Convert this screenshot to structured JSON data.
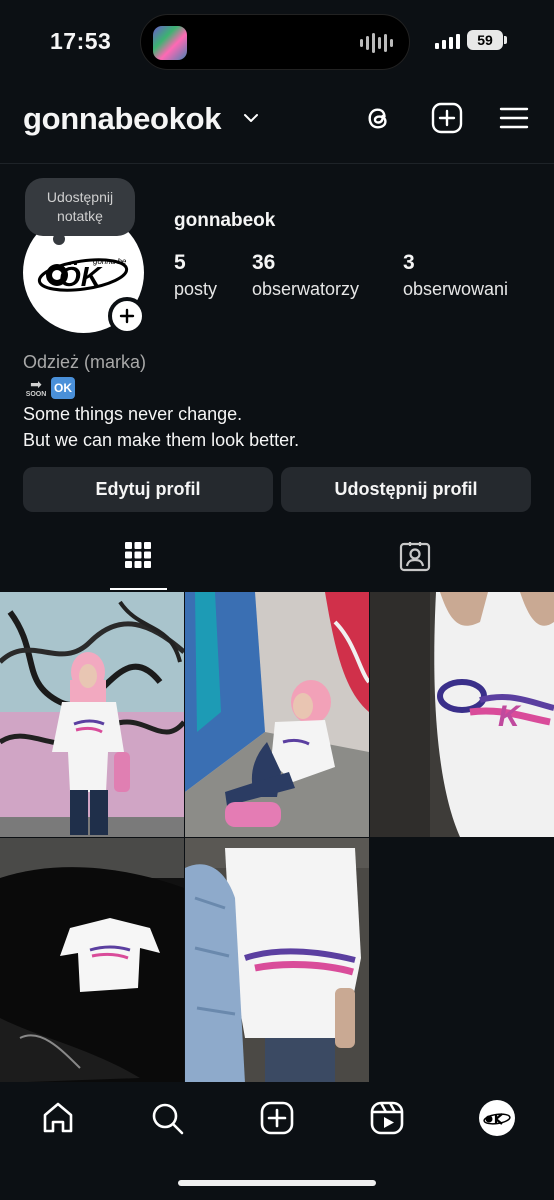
{
  "status_bar": {
    "time": "17:53",
    "battery": "59"
  },
  "header": {
    "username": "gonnabeokok",
    "icons": [
      "chevron-down-icon",
      "threads-icon",
      "create-plus-icon",
      "menu-icon"
    ]
  },
  "profile": {
    "note_line1": "Udostępnij",
    "note_line2": "notatkę",
    "avatar_logo_small": "gonna be",
    "avatar_logo_big": "ÖK",
    "display_name": "gonnabeok",
    "stats": [
      {
        "value": "5",
        "label": "posty"
      },
      {
        "value": "36",
        "label": "obserwatorzy"
      },
      {
        "value": "3",
        "label": "obserwowani"
      }
    ],
    "category": "Odzież (marka)",
    "soon_text": "SOON",
    "ok_emoji": "OK",
    "bio_line1": "Some things never change.",
    "bio_line2": "But we can make them look better."
  },
  "actions": {
    "edit_profile": "Edytuj profil",
    "share_profile": "Udostępnij profil"
  },
  "tabs": {
    "active": "grid",
    "items": [
      "grid-icon",
      "tagged-icon"
    ]
  },
  "grid": {
    "posts": [
      {
        "description": "girl in white tee, graffiti wall"
      },
      {
        "description": "girl sitting by graffiti wall"
      },
      {
        "description": "white tee close-up with logo"
      },
      {
        "description": "white tee on black car hood"
      },
      {
        "description": "white tee with denim jacket"
      }
    ]
  },
  "bottom_nav": {
    "items": [
      "home-icon",
      "search-icon",
      "create-icon",
      "reels-icon",
      "profile-avatar"
    ]
  },
  "colors": {
    "background": "#0c1014",
    "button": "#25292e",
    "text": "#f5f5f5",
    "muted": "#a8a8a8",
    "logo_purple": "#5b3fa0",
    "logo_pink": "#d94c9a"
  }
}
